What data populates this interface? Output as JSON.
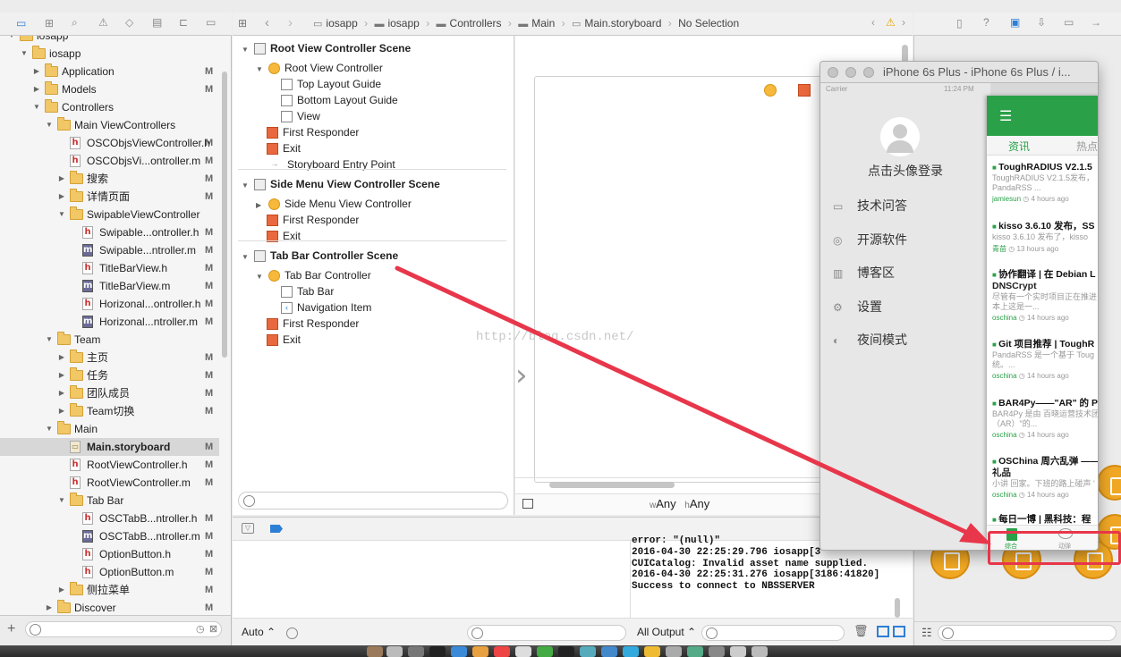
{
  "breadcrumb": {
    "items": [
      "iosapp",
      "iosapp",
      "Controllers",
      "Main",
      "Main.storyboard",
      "No Selection"
    ]
  },
  "navigator": {
    "rows": [
      {
        "label": "iosapp",
        "indent": 0,
        "type": "project",
        "disclosure": "open",
        "flag": ""
      },
      {
        "label": "iosapp",
        "indent": 1,
        "type": "folder",
        "disclosure": "open",
        "flag": ""
      },
      {
        "label": "Application",
        "indent": 2,
        "type": "folder",
        "disclosure": "closed",
        "flag": "M"
      },
      {
        "label": "Models",
        "indent": 2,
        "type": "folder",
        "disclosure": "closed",
        "flag": "M"
      },
      {
        "label": "Controllers",
        "indent": 2,
        "type": "folder",
        "disclosure": "open",
        "flag": ""
      },
      {
        "label": "Main ViewControllers",
        "indent": 3,
        "type": "folder",
        "disclosure": "open",
        "flag": ""
      },
      {
        "label": "OSCObjsViewController.h",
        "indent": 4,
        "type": "h",
        "disclosure": "",
        "flag": "M"
      },
      {
        "label": "OSCObjsVi...ontroller.m",
        "indent": 4,
        "type": "h",
        "disclosure": "",
        "flag": "M"
      },
      {
        "label": "搜索",
        "indent": 4,
        "type": "folder",
        "disclosure": "closed",
        "flag": "M"
      },
      {
        "label": "详情页面",
        "indent": 4,
        "type": "folder",
        "disclosure": "closed",
        "flag": "M"
      },
      {
        "label": "SwipableViewController",
        "indent": 4,
        "type": "folder",
        "disclosure": "open",
        "flag": ""
      },
      {
        "label": "Swipable...ontroller.h",
        "indent": 5,
        "type": "h",
        "disclosure": "",
        "flag": "M"
      },
      {
        "label": "Swipable...ntroller.m",
        "indent": 5,
        "type": "m",
        "disclosure": "",
        "flag": "M"
      },
      {
        "label": "TitleBarView.h",
        "indent": 5,
        "type": "h",
        "disclosure": "",
        "flag": "M"
      },
      {
        "label": "TitleBarView.m",
        "indent": 5,
        "type": "m",
        "disclosure": "",
        "flag": "M"
      },
      {
        "label": "Horizonal...ontroller.h",
        "indent": 5,
        "type": "h",
        "disclosure": "",
        "flag": "M"
      },
      {
        "label": "Horizonal...ntroller.m",
        "indent": 5,
        "type": "m",
        "disclosure": "",
        "flag": "M"
      },
      {
        "label": "Team",
        "indent": 3,
        "type": "folder",
        "disclosure": "open",
        "flag": ""
      },
      {
        "label": "主页",
        "indent": 4,
        "type": "folder",
        "disclosure": "closed",
        "flag": "M"
      },
      {
        "label": "任务",
        "indent": 4,
        "type": "folder",
        "disclosure": "closed",
        "flag": "M"
      },
      {
        "label": "团队成员",
        "indent": 4,
        "type": "folder",
        "disclosure": "closed",
        "flag": "M"
      },
      {
        "label": "Team切换",
        "indent": 4,
        "type": "folder",
        "disclosure": "closed",
        "flag": "M"
      },
      {
        "label": "Main",
        "indent": 3,
        "type": "folder",
        "disclosure": "open",
        "flag": ""
      },
      {
        "label": "Main.storyboard",
        "indent": 4,
        "type": "sb",
        "disclosure": "",
        "flag": "M",
        "selected": true
      },
      {
        "label": "RootViewController.h",
        "indent": 4,
        "type": "h",
        "disclosure": "",
        "flag": "M"
      },
      {
        "label": "RootViewController.m",
        "indent": 4,
        "type": "h",
        "disclosure": "",
        "flag": "M"
      },
      {
        "label": "Tab Bar",
        "indent": 4,
        "type": "folder",
        "disclosure": "open",
        "flag": ""
      },
      {
        "label": "OSCTabB...ntroller.h",
        "indent": 5,
        "type": "h",
        "disclosure": "",
        "flag": "M"
      },
      {
        "label": "OSCTabB...ntroller.m",
        "indent": 5,
        "type": "m",
        "disclosure": "",
        "flag": "M"
      },
      {
        "label": "OptionButton.h",
        "indent": 5,
        "type": "h",
        "disclosure": "",
        "flag": "M"
      },
      {
        "label": "OptionButton.m",
        "indent": 5,
        "type": "h",
        "disclosure": "",
        "flag": "M"
      },
      {
        "label": "侧拉菜单",
        "indent": 4,
        "type": "folder",
        "disclosure": "closed",
        "flag": "M"
      },
      {
        "label": "Discover",
        "indent": 3,
        "type": "folder",
        "disclosure": "closed",
        "flag": "M"
      }
    ]
  },
  "outline": {
    "rows": [
      {
        "label": "Root View Controller Scene",
        "kind": "scene"
      },
      {
        "label": "Root View Controller",
        "kind": "vc"
      },
      {
        "label": "Top Layout Guide",
        "kind": "guide"
      },
      {
        "label": "Bottom Layout Guide",
        "kind": "guide"
      },
      {
        "label": "View",
        "kind": "guide"
      },
      {
        "label": "First Responder",
        "kind": "fr"
      },
      {
        "label": "Exit",
        "kind": "ex"
      },
      {
        "label": "Storyboard Entry Point",
        "kind": "arrow"
      },
      {
        "label": "Side Menu View Controller Scene",
        "kind": "scene"
      },
      {
        "label": "Side Menu View Controller",
        "kind": "vc"
      },
      {
        "label": "First Responder",
        "kind": "fr"
      },
      {
        "label": "Exit",
        "kind": "ex"
      },
      {
        "label": "Tab Bar Controller Scene",
        "kind": "scene"
      },
      {
        "label": "Tab Bar Controller",
        "kind": "vc"
      },
      {
        "label": "Tab Bar",
        "kind": "guide"
      },
      {
        "label": "Navigation Item",
        "kind": "nav"
      },
      {
        "label": "First Responder",
        "kind": "fr"
      },
      {
        "label": "Exit",
        "kind": "ex"
      }
    ]
  },
  "canvas": {
    "size_w": "Any",
    "size_h": "Any",
    "w_prefix": "w",
    "h_prefix": "h"
  },
  "watermark": "http://blog.csdn.net/",
  "simulator": {
    "title": "iPhone 6s Plus - iPhone 6s Plus / i...",
    "carrier": "Carrier",
    "time": "11:24 PM",
    "login": "点击头像登录",
    "menu": [
      {
        "label": "技术问答",
        "icon": "qa-icon"
      },
      {
        "label": "开源软件",
        "icon": "opensource-icon"
      },
      {
        "label": "博客区",
        "icon": "blog-icon"
      },
      {
        "label": "设置",
        "icon": "settings-icon"
      },
      {
        "label": "夜间模式",
        "icon": "night-icon"
      }
    ],
    "tabs": [
      "资讯",
      "热点"
    ],
    "feed": [
      {
        "title": "ToughRADIUS V2.1.5",
        "summary": "ToughRADIUS V2.1.5发布，",
        "summary2": "PandaRSS ...",
        "author": "jamiesun",
        "time": "4 hours ago"
      },
      {
        "title": "kisso 3.6.10 发布，SS",
        "summary": "kisso 3.6.10 发布了，kisso",
        "summary2": "",
        "author": "青苗",
        "time": "13 hours ago"
      },
      {
        "title": "协作翻译 | 在 Debian L",
        "title2": "DNSCrypt",
        "summary": "尽管有一个实时项目正在推进",
        "summary2": "本上这是一...",
        "author": "oschina",
        "time": "14 hours ago"
      },
      {
        "title": "Git 项目推荐 | ToughR",
        "summary": "PandaRSS 是一个基于 Toug",
        "summary2": "统。...",
        "author": "oschina",
        "time": "14 hours ago"
      },
      {
        "title": "BAR4Py——\"AR\" 的 P",
        "summary": "BAR4Py 是由 百晓运营技术团",
        "summary2": "（AR）\"的...",
        "author": "oschina",
        "time": "14 hours ago"
      },
      {
        "title": "OSChina 周六乱弹 ——",
        "title2": "礼品",
        "summary": "小讲 回家。下班的路上碰声 '",
        "summary2": "",
        "author": "oschina",
        "time": "14 hours ago"
      },
      {
        "title": "每日一博 | 黑科技：程",
        "summary": "",
        "summary2": "",
        "author": "",
        "time": ""
      }
    ],
    "bottom_tabs": [
      "综合",
      "动弹"
    ]
  },
  "console": {
    "lines": [
      "error: \"(null)\"",
      "2016-04-30 22:25:29.796 iosapp[3",
      "CUICatalog: Invalid asset name supplied.",
      "2016-04-30 22:25:31.276 iosapp[3186:41820]",
      "Success to connect to NBSSERVER"
    ],
    "output_select": "All Output ⌃",
    "auto_select": "Auto ⌃"
  },
  "colors": {
    "accent_green": "#2aa148",
    "annotation_red": "#e8364a",
    "object_orange": "#f0a724"
  }
}
